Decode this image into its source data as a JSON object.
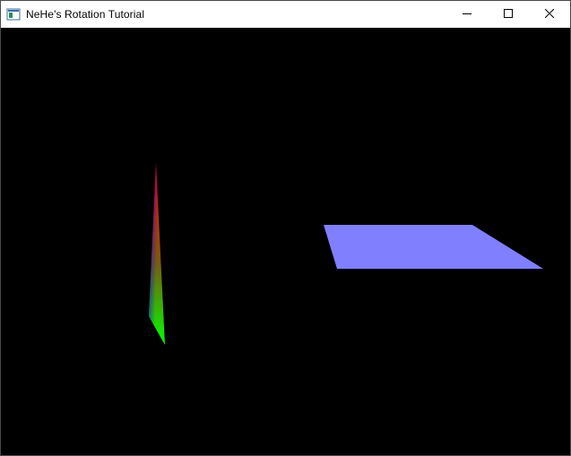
{
  "window": {
    "title": "NeHe's Rotation Tutorial",
    "app_icon": "window-app-icon",
    "buttons": {
      "minimize": "minimize-icon",
      "maximize": "maximize-icon",
      "close": "close-icon"
    }
  },
  "scene": {
    "background": "#000000",
    "triangle": {
      "colors": [
        "#ff0000",
        "#00ff00",
        "#0000ff"
      ]
    },
    "quad": {
      "color": "#8080ff"
    }
  }
}
